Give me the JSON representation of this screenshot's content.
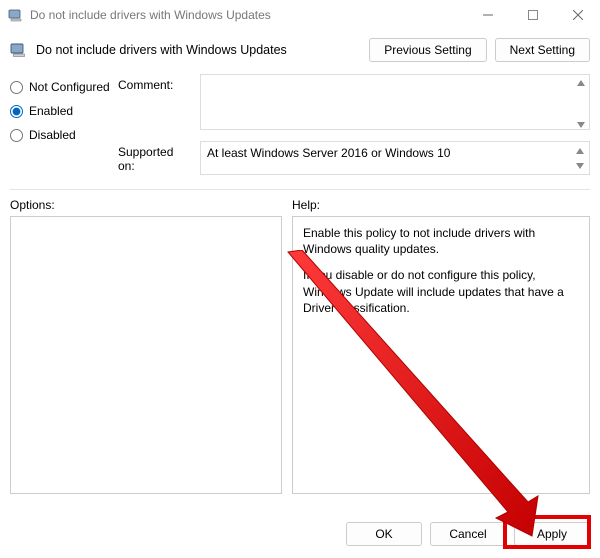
{
  "window": {
    "title": "Do not include drivers with Windows Updates"
  },
  "header": {
    "title": "Do not include drivers with Windows Updates",
    "prev_btn": "Previous Setting",
    "next_btn": "Next Setting"
  },
  "config": {
    "radios": {
      "not_configured": "Not Configured",
      "enabled": "Enabled",
      "disabled": "Disabled",
      "selected": "enabled"
    },
    "comment_label": "Comment:",
    "comment_value": "",
    "supported_label": "Supported on:",
    "supported_value": "At least Windows Server 2016 or Windows 10"
  },
  "labels": {
    "options": "Options:",
    "help": "Help:"
  },
  "help": {
    "p1": "Enable this policy to not include drivers with Windows quality updates.",
    "p2": "If you disable or do not configure this policy, Windows Update will include updates that have a Driver classification."
  },
  "buttons": {
    "ok": "OK",
    "cancel": "Cancel",
    "apply": "Apply"
  }
}
